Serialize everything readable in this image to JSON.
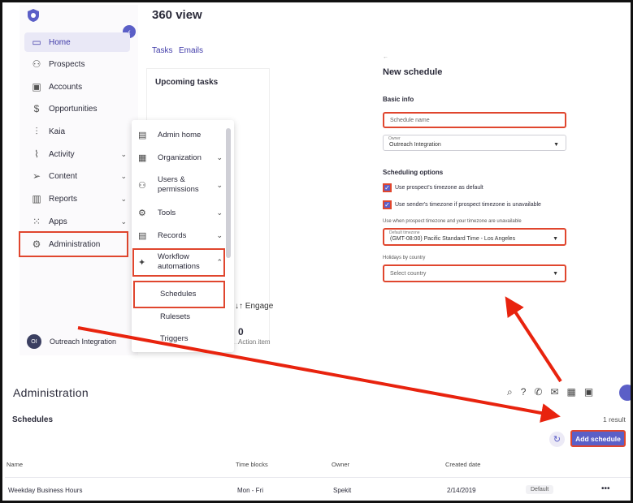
{
  "sidebar": {
    "items": [
      {
        "label": "Home",
        "icon": "home-icon",
        "glyph": "▭"
      },
      {
        "label": "Prospects",
        "icon": "person-icon",
        "glyph": "⚇"
      },
      {
        "label": "Accounts",
        "icon": "briefcase-icon",
        "glyph": "▣"
      },
      {
        "label": "Opportunities",
        "icon": "dollar-icon",
        "glyph": "$"
      },
      {
        "label": "Kaia",
        "icon": "waveform-icon",
        "glyph": "⫶"
      },
      {
        "label": "Activity",
        "icon": "activity-icon",
        "glyph": "⌇"
      },
      {
        "label": "Content",
        "icon": "send-icon",
        "glyph": "➢"
      },
      {
        "label": "Reports",
        "icon": "bar-chart-icon",
        "glyph": "▥"
      },
      {
        "label": "Apps",
        "icon": "grid-icon",
        "glyph": "⁙"
      },
      {
        "label": "Administration",
        "icon": "gear-icon",
        "glyph": "⚙"
      }
    ],
    "user": {
      "initials": "OI",
      "name": "Outreach Integration"
    }
  },
  "view": {
    "title": "360 view",
    "tabs": [
      "Tasks",
      "Emails"
    ],
    "upcoming_title": "Upcoming tasks",
    "engage_label": "Engage",
    "engage_value": "0",
    "engage_sub": "Action item"
  },
  "menu": {
    "items": [
      {
        "label": "Admin home",
        "icon": "layout-icon",
        "glyph": "▤",
        "chev": ""
      },
      {
        "label": "Organization",
        "icon": "building-icon",
        "glyph": "▦",
        "chev": "⌄"
      },
      {
        "label": "Users & permissions",
        "icon": "user-settings-icon",
        "glyph": "⚇",
        "chev": "⌄"
      },
      {
        "label": "Tools",
        "icon": "tools-icon",
        "glyph": "⚙",
        "chev": "⌄"
      },
      {
        "label": "Records",
        "icon": "records-icon",
        "glyph": "▤",
        "chev": "⌄"
      },
      {
        "label": "Workflow automations",
        "icon": "magic-wand-icon",
        "glyph": "✦",
        "chev": "⌃"
      }
    ],
    "sub_items": [
      "Schedules",
      "Rulesets",
      "Triggers"
    ]
  },
  "new_schedule": {
    "back": "←",
    "title": "New schedule",
    "basic_info": "Basic info",
    "schedule_name_placeholder": "Schedule name",
    "owner_label": "Owner",
    "owner_value": "Outreach Integration",
    "scheduling_options": "Scheduling options",
    "check1": "Use prospect's timezone as default",
    "check2": "Use sender's timezone if prospect timezone is unavailable",
    "note": "Use when prospect timezone and your timezone are unavailable",
    "timezone_label": "Default timezone",
    "timezone_value": "(GMT-08:00) Pacific Standard Time - Los Angeles",
    "holidays_label": "Holidays by country",
    "country_placeholder": "Select country"
  },
  "admin": {
    "title": "Administration",
    "section": "Schedules",
    "result": "1 result",
    "add_button": "Add schedule",
    "columns": [
      "Name",
      "Time blocks",
      "Owner",
      "Created date"
    ],
    "rows": [
      {
        "name": "Weekday Business Hours",
        "time_blocks": "Mon - Fri",
        "owner": "Spekit",
        "created": "2/14/2019",
        "tag": "Default",
        "more": "•••"
      }
    ],
    "top_icons": [
      "search-icon",
      "help-icon",
      "phone-icon",
      "mail-icon",
      "calendar-icon",
      "dialer-icon"
    ]
  },
  "colors": {
    "accent": "#5b5fc7",
    "highlight": "#e0462e"
  }
}
